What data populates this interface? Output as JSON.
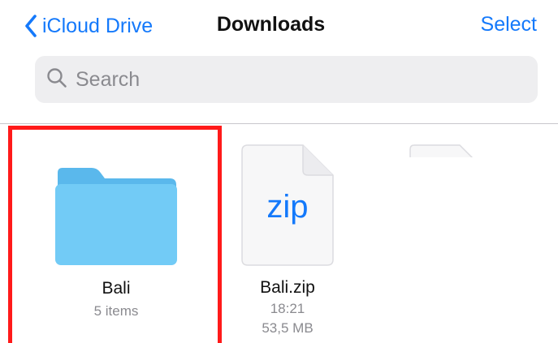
{
  "navbar": {
    "back_label": "iCloud Drive",
    "title": "Downloads",
    "select_label": "Select"
  },
  "search": {
    "placeholder": "Search",
    "value": ""
  },
  "items": [
    {
      "name": "Bali",
      "meta": "5 items",
      "icon": "folder-icon"
    },
    {
      "name": "Bali.zip",
      "icon_text": "zip",
      "time": "18:21",
      "size": "53,5 MB",
      "icon": "zip-file-icon"
    },
    {
      "icon": "document-icon"
    }
  ],
  "colors": {
    "accent": "#1479fb",
    "folder": "#6cc6f4",
    "highlight": "#ff1a1a"
  }
}
